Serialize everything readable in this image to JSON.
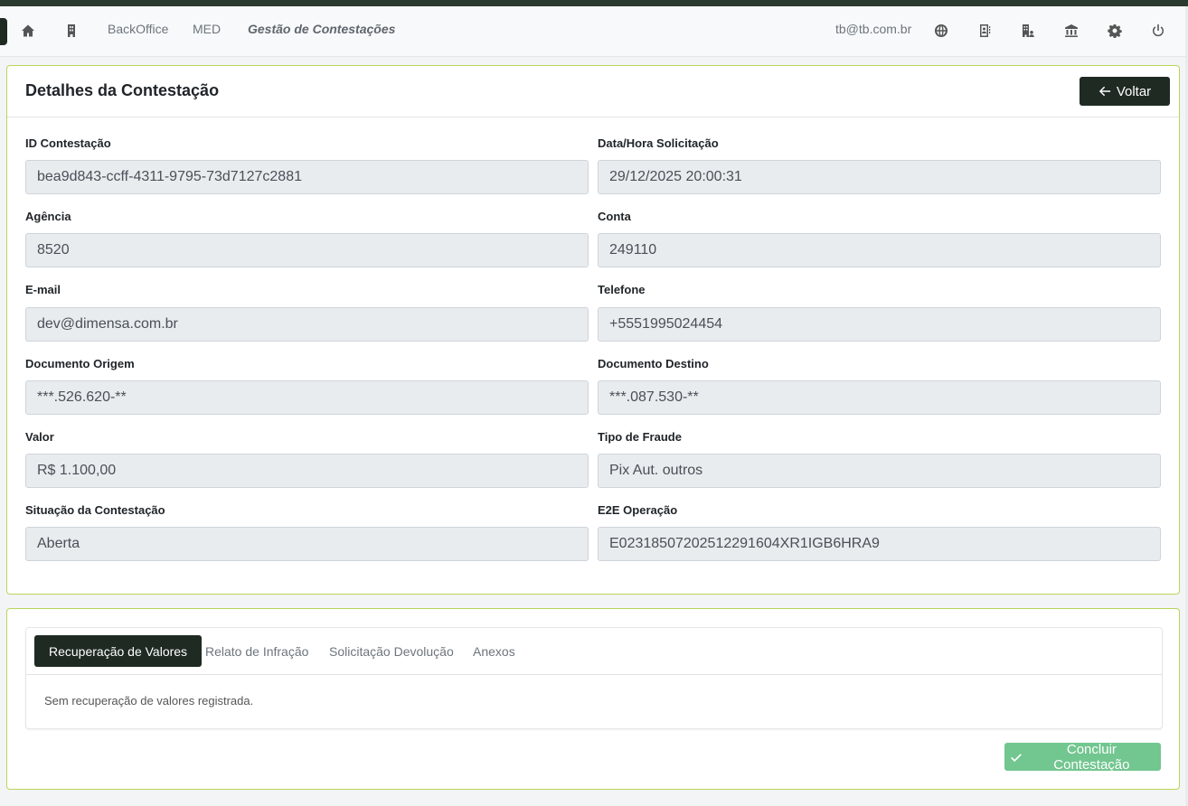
{
  "nav": {
    "links": [
      "BackOffice",
      "MED",
      "Gestão de Contestações"
    ],
    "user_email": "tb@tb.com.br",
    "icons": [
      "home-icon",
      "building-icon",
      "globe-icon",
      "contact-book-icon",
      "building-user-icon",
      "bank-icon",
      "gear-icon",
      "power-icon"
    ]
  },
  "details": {
    "title": "Detalhes da Contestação",
    "back_label": "Voltar",
    "fields": [
      {
        "label": "ID Contestação",
        "value": "bea9d843-ccff-4311-9795-73d7127c2881"
      },
      {
        "label": "Data/Hora Solicitação",
        "value": "29/12/2025 20:00:31"
      },
      {
        "label": "Agência",
        "value": "8520"
      },
      {
        "label": "Conta",
        "value": "249110"
      },
      {
        "label": "E-mail",
        "value": "dev@dimensa.com.br"
      },
      {
        "label": "Telefone",
        "value": "+5551995024454"
      },
      {
        "label": "Documento Origem",
        "value": "***.526.620-**"
      },
      {
        "label": "Documento Destino",
        "value": "***.087.530-**"
      },
      {
        "label": "Valor",
        "value": "R$ 1.100,00"
      },
      {
        "label": "Tipo de Fraude",
        "value": "Pix Aut. outros"
      },
      {
        "label": "Situação da Contestação",
        "value": "Aberta"
      },
      {
        "label": "E2E Operação",
        "value": "E02318507202512291604XR1IGB6HRA9"
      }
    ]
  },
  "tabs": {
    "items": [
      "Recuperação de Valores",
      "Relato de Infração",
      "Solicitação Devolução",
      "Anexos"
    ],
    "active_index": 0,
    "content": "Sem recuperação de valores registrada."
  },
  "actions": {
    "conclude_label": "Concluir Contestação"
  },
  "colors": {
    "primary_dark": "#1f2a23",
    "card_border": "#b8d55a",
    "success_light": "#72c68f",
    "input_bg": "#e9ecef"
  }
}
